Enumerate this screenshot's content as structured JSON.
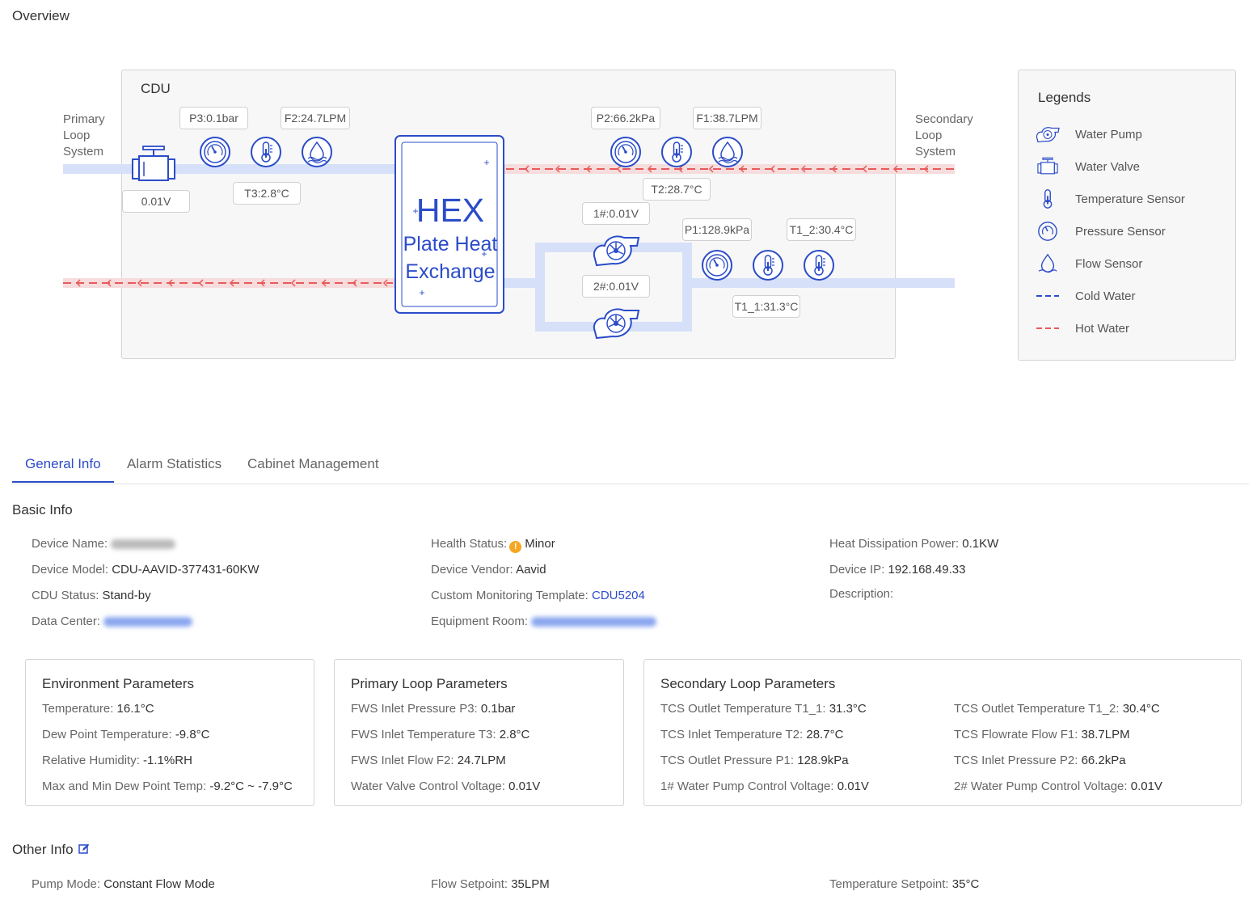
{
  "overview": {
    "title": "Overview",
    "cdu_label": "CDU",
    "primary_loop_label": [
      "Primary",
      "Loop",
      "System"
    ],
    "secondary_loop_label": [
      "Secondary",
      "Loop",
      "System"
    ],
    "hex": {
      "title": "HEX",
      "line1": "Plate Heat",
      "line2": "Exchange"
    },
    "tags": {
      "p3": "P3:0.1bar",
      "f2": "F2:24.7LPM",
      "valve": "0.01V",
      "t3": "T3:2.8°C",
      "p2": "P2:66.2kPa",
      "f1": "F1:38.7LPM",
      "t2": "T2:28.7°C",
      "pump1": "1#:0.01V",
      "pump2": "2#:0.01V",
      "p1": "P1:128.9kPa",
      "t1_2": "T1_2:30.4°C",
      "t1_1": "T1_1:31.3°C"
    },
    "colors": {
      "cold": "#d6e0f8",
      "hot": "#e85a5a",
      "hot_bg": "#f6dcdc",
      "icon": "#2b4cc8"
    }
  },
  "legends": {
    "title": "Legends",
    "items": [
      {
        "icon": "water-pump-icon",
        "label": "Water Pump"
      },
      {
        "icon": "water-valve-icon",
        "label": "Water Valve"
      },
      {
        "icon": "temperature-sensor-icon",
        "label": "Temperature Sensor"
      },
      {
        "icon": "pressure-sensor-icon",
        "label": "Pressure Sensor"
      },
      {
        "icon": "flow-sensor-icon",
        "label": "Flow Sensor"
      },
      {
        "icon": "cold-water-line-icon",
        "label": "Cold Water"
      },
      {
        "icon": "hot-water-line-icon",
        "label": "Hot Water"
      }
    ]
  },
  "tabs": [
    "General Info",
    "Alarm Statistics",
    "Cabinet Management"
  ],
  "basic_info": {
    "title": "Basic Info",
    "device_name_label": "Device Name:",
    "health_status_label": "Health Status:",
    "health_status_value": "Minor",
    "heat_power_label": "Heat Dissipation Power:",
    "heat_power_value": "0.1KW",
    "device_model_label": "Device Model:",
    "device_model_value": "CDU-AAVID-377431-60KW",
    "device_vendor_label": "Device Vendor:",
    "device_vendor_value": "Aavid",
    "device_ip_label": "Device IP:",
    "device_ip_value": "192.168.49.33",
    "cdu_status_label": "CDU Status:",
    "cdu_status_value": "Stand-by",
    "template_label": "Custom Monitoring Template:",
    "template_value": "CDU5204",
    "description_label": "Description:",
    "data_center_label": "Data Center:",
    "equipment_room_label": "Equipment Room:"
  },
  "environment": {
    "title": "Environment Parameters",
    "rows": [
      {
        "label": "Temperature:",
        "value": "16.1°C"
      },
      {
        "label": "Dew Point Temperature:",
        "value": "-9.8°C"
      },
      {
        "label": "Relative Humidity:",
        "value": "-1.1%RH"
      },
      {
        "label": "Max and Min Dew Point Temp:",
        "value": "-9.2°C ~ -7.9°C"
      }
    ]
  },
  "primary_loop": {
    "title": "Primary Loop Parameters",
    "rows": [
      {
        "label": "FWS Inlet Pressure P3:",
        "value": "0.1bar"
      },
      {
        "label": "FWS Inlet Temperature T3:",
        "value": "2.8°C"
      },
      {
        "label": "FWS Inlet Flow F2:",
        "value": "24.7LPM"
      },
      {
        "label": "Water Valve Control Voltage:",
        "value": "0.01V"
      }
    ]
  },
  "secondary_loop": {
    "title": "Secondary Loop Parameters",
    "left": [
      {
        "label": "TCS Outlet Temperature T1_1:",
        "value": "31.3°C"
      },
      {
        "label": "TCS Inlet Temperature T2:",
        "value": "28.7°C"
      },
      {
        "label": "TCS Outlet Pressure P1:",
        "value": "128.9kPa"
      },
      {
        "label": "1# Water Pump Control Voltage:",
        "value": "0.01V"
      }
    ],
    "right": [
      {
        "label": "TCS Outlet Temperature T1_2:",
        "value": "30.4°C"
      },
      {
        "label": "TCS Flowrate Flow F1:",
        "value": "38.7LPM"
      },
      {
        "label": "TCS Inlet Pressure P2:",
        "value": "66.2kPa"
      },
      {
        "label": "2# Water Pump Control Voltage:",
        "value": "0.01V"
      }
    ]
  },
  "other_info": {
    "title": "Other Info",
    "pump_mode_label": "Pump Mode:",
    "pump_mode_value": "Constant Flow Mode",
    "flow_setpoint_label": "Flow Setpoint:",
    "flow_setpoint_value": "35LPM",
    "temp_setpoint_label": "Temperature Setpoint:",
    "temp_setpoint_value": "35°C"
  }
}
